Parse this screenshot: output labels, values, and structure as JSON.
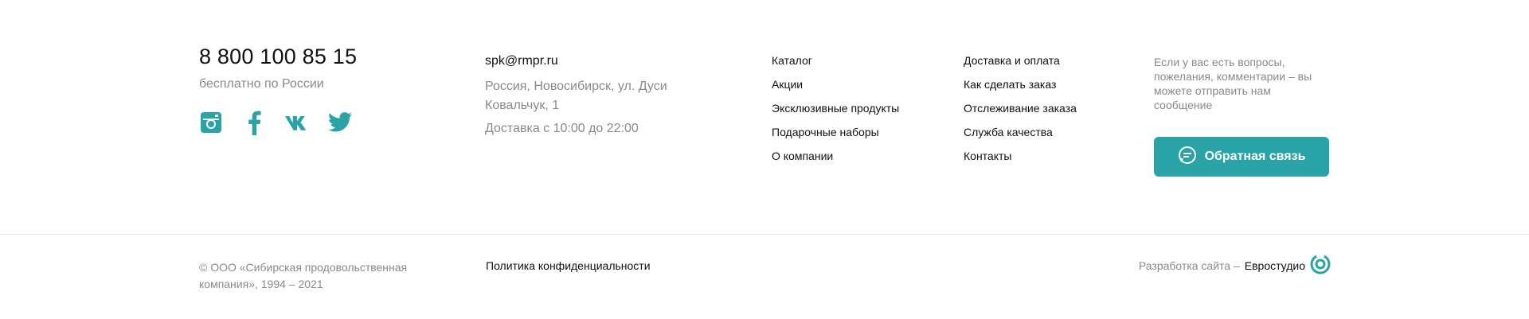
{
  "contacts": {
    "phone": "8 800 100 85 15",
    "phone_note": "бесплатно по России",
    "email": "spk@rmpr.ru",
    "address": "Россия, Новосибирск, ул. Дуси Ковальчук, 1",
    "delivery_hours": "Доставка с 10:00 до 22:00"
  },
  "socials": [
    {
      "icon": "instagram-icon",
      "color": "#2aa3a7"
    },
    {
      "icon": "facebook-icon",
      "color": "#2aa3a7"
    },
    {
      "icon": "vk-icon",
      "color": "#2aa3a7"
    },
    {
      "icon": "twitter-icon",
      "color": "#2aa3a7"
    }
  ],
  "nav_col_1": [
    "Каталог",
    "Акции",
    "Эксклюзивные продукты",
    "Подарочные наборы",
    "О компании"
  ],
  "nav_col_2": [
    "Доставка и оплата",
    "Как сделать заказ",
    "Отслеживание заказа",
    "Служба качества",
    "Контакты"
  ],
  "feedback": {
    "text": "Если у вас есть вопросы, пожелания, комментарии – вы можете отправить нам сообщение",
    "button_label": "Обратная связь",
    "button_icon": "chat-bubble-icon",
    "button_color": "#2aa3a7"
  },
  "bottom": {
    "copyright": "© ООО «Сибирская продовольственная компания», 1994 – 2021",
    "privacy": "Политика конфиденциальности",
    "dev_prefix": "Разработка сайта –",
    "dev_name": "Евростудио",
    "dev_icon": "evrostudio-logo-icon"
  }
}
